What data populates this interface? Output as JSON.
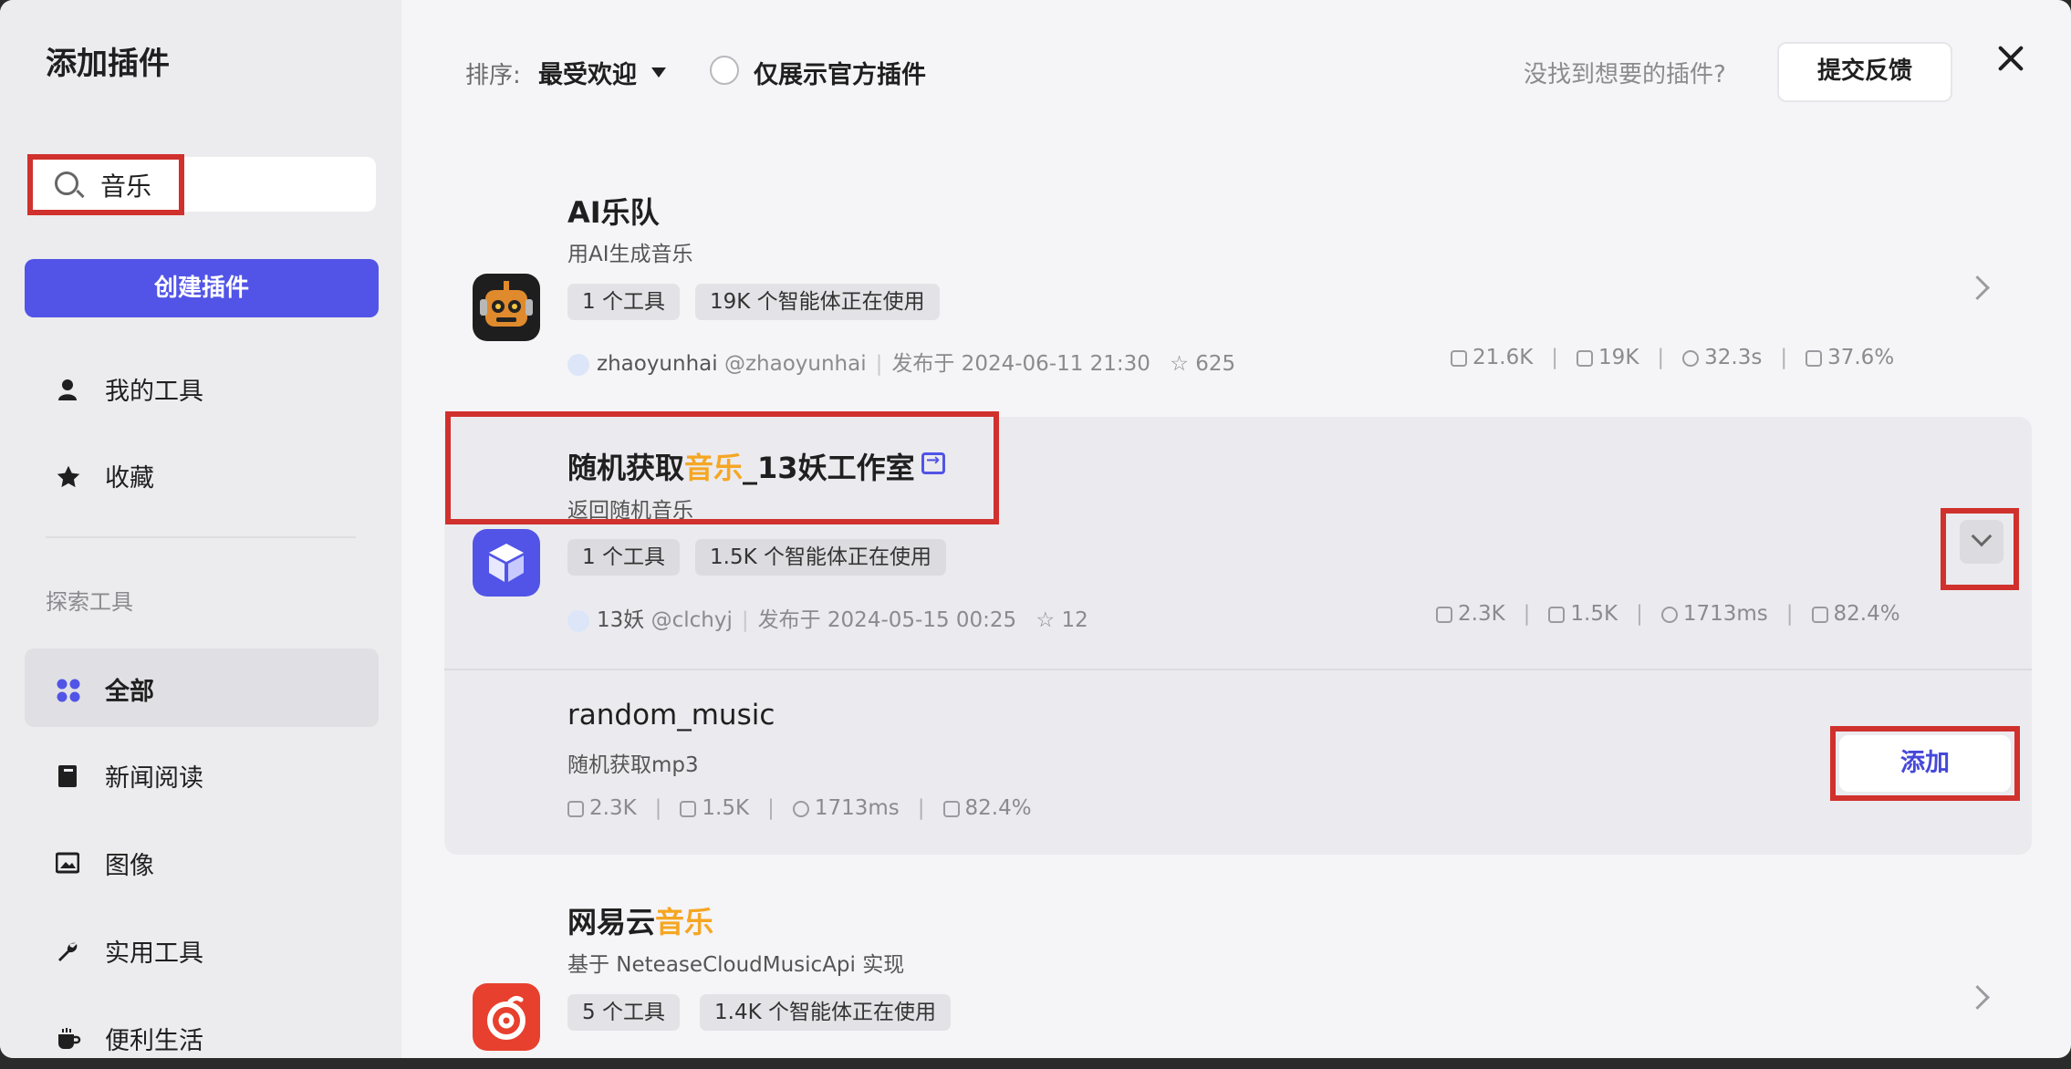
{
  "sidebar": {
    "title": "添加插件",
    "search": {
      "value": "音乐"
    },
    "create_label": "创建插件",
    "items": [
      {
        "label": "我的工具",
        "icon": "person-icon"
      },
      {
        "label": "收藏",
        "icon": "star-icon"
      }
    ],
    "section_title": "探索工具",
    "categories": [
      {
        "label": "全部",
        "icon": "grid-icon",
        "active": true
      },
      {
        "label": "新闻阅读",
        "icon": "book-icon"
      },
      {
        "label": "图像",
        "icon": "image-icon"
      },
      {
        "label": "实用工具",
        "icon": "wrench-icon"
      },
      {
        "label": "便利生活",
        "icon": "cup-icon"
      }
    ]
  },
  "topbar": {
    "sort_label": "排序:",
    "sort_value": "最受欢迎",
    "official_only_label": "仅展示官方插件",
    "not_found_text": "没找到想要的插件?",
    "feedback_label": "提交反馈"
  },
  "plugins": [
    {
      "title": "AI乐队",
      "description": "用AI生成音乐",
      "tags": [
        "1 个工具",
        "19K 个智能体正在使用"
      ],
      "author": "zhaoyunhai",
      "handle": "@zhaoyunhai",
      "published": "发布于 2024-06-11 21:30",
      "stars": "625",
      "stats": [
        "21.6K",
        "19K",
        "32.3s",
        "37.6%"
      ]
    },
    {
      "title_prefix": "随机获取",
      "title_highlight": "音乐",
      "title_suffix": "_13妖工作室",
      "description": "返回随机音乐",
      "tags": [
        "1 个工具",
        "1.5K 个智能体正在使用"
      ],
      "author": "13妖",
      "handle": "@clchyj",
      "published": "发布于 2024-05-15 00:25",
      "stars": "12",
      "stats": [
        "2.3K",
        "1.5K",
        "1713ms",
        "82.4%"
      ],
      "tool": {
        "name": "random_music",
        "description": "随机获取mp3",
        "stats": [
          "2.3K",
          "1.5K",
          "1713ms",
          "82.4%"
        ],
        "add_label": "添加"
      }
    },
    {
      "title_prefix": "网易云",
      "title_highlight": "音乐",
      "description": "基于 NeteaseCloudMusicApi 实现",
      "tags": [
        "5 个工具",
        "1.4K 个智能体正在使用"
      ]
    }
  ],
  "colors": {
    "accent": "#5154e6",
    "highlight": "#f5a623",
    "annotation_red": "#d0312d"
  }
}
